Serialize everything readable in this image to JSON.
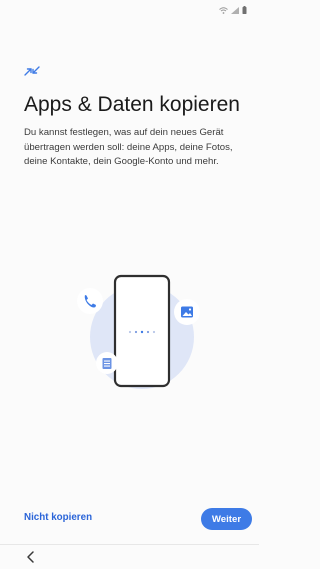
{
  "status_bar": {
    "icons": [
      "wifi-icon",
      "signal-icon",
      "battery-icon"
    ]
  },
  "header": {
    "icon": "transfer-arrows-icon",
    "title": "Apps & Daten kopieren",
    "description": "Du kannst festlegen, was auf dein neues Gerät übertragen werden soll: deine Apps, deine Fotos, deine Kontakte, dein Google-Konto und mehr."
  },
  "illustration": {
    "icons": [
      "phone-call-icon",
      "image-icon",
      "document-icon",
      "smartphone-icon"
    ]
  },
  "actions": {
    "skip_label": "Nicht kopieren",
    "next_label": "Weiter"
  },
  "navigation": {
    "back_icon": "chevron-left-icon"
  },
  "colors": {
    "accent": "#3e7be6",
    "link": "#2a64d8",
    "illustration_bg": "#dfe6f7"
  }
}
